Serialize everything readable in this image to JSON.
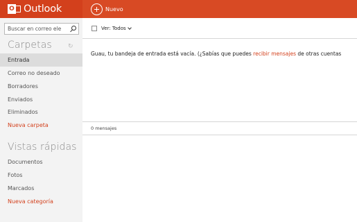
{
  "header": {
    "logo_letter": "O",
    "app_name": "Outlook",
    "new_label": "Nuevo",
    "colors": {
      "bar": "#d84a24",
      "brand": "#d3401c"
    }
  },
  "sidebar": {
    "search_placeholder": "Buscar en correo ele",
    "folders_title": "Carpetas",
    "folders": [
      {
        "label": "Entrada",
        "active": true
      },
      {
        "label": "Correo no deseado"
      },
      {
        "label": "Borradores"
      },
      {
        "label": "Enviados"
      },
      {
        "label": "Eliminados"
      }
    ],
    "new_folder": "Nueva carpeta",
    "quick_views_title": "Vistas rápidas",
    "quick_views": [
      {
        "label": "Documentos"
      },
      {
        "label": "Fotos"
      },
      {
        "label": "Marcados"
      }
    ],
    "new_category": "Nueva categoría"
  },
  "main": {
    "view_filter": "Ver: Todos",
    "empty_before": "Guau, tu bandeja de entrada está vacía. (¿Sabías que puedes ",
    "empty_link": "recibir mensajes",
    "empty_after": " de otras cuentas",
    "message_count": "0 mensajes"
  }
}
